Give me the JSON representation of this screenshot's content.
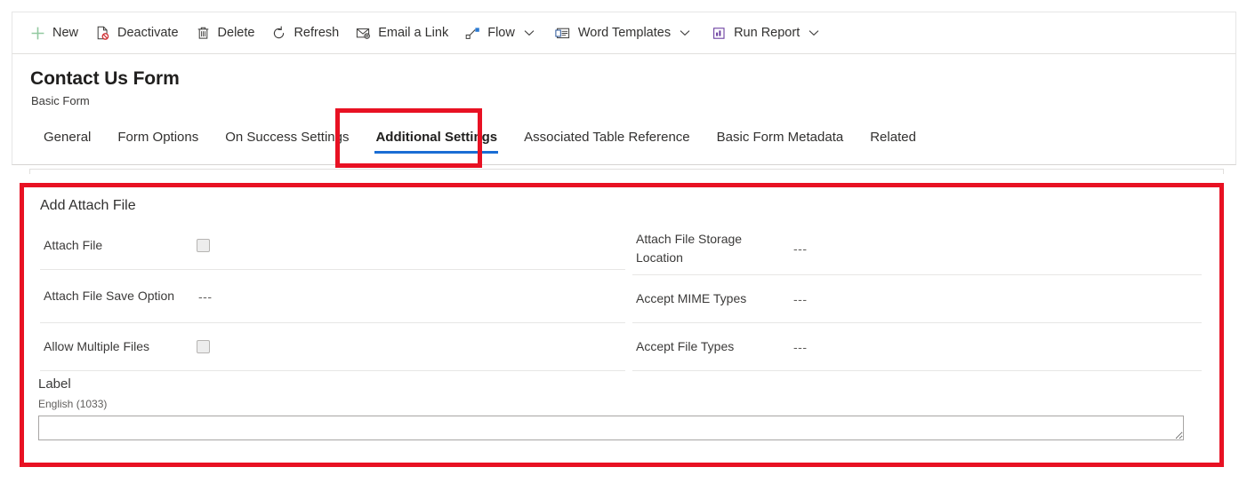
{
  "command_bar": {
    "items": [
      {
        "label": "New",
        "icon": "plus-icon",
        "has_caret": false
      },
      {
        "label": "Deactivate",
        "icon": "deactivate-icon",
        "has_caret": false
      },
      {
        "label": "Delete",
        "icon": "trash-icon",
        "has_caret": false
      },
      {
        "label": "Refresh",
        "icon": "refresh-icon",
        "has_caret": false
      },
      {
        "label": "Email a Link",
        "icon": "email-link-icon",
        "has_caret": false
      },
      {
        "label": "Flow",
        "icon": "flow-icon",
        "has_caret": true
      },
      {
        "label": "Word Templates",
        "icon": "word-templates-icon",
        "has_caret": true
      },
      {
        "label": "Run Report",
        "icon": "run-report-icon",
        "has_caret": true
      }
    ]
  },
  "header": {
    "title": "Contact Us Form",
    "subtitle": "Basic Form",
    "tabs": [
      {
        "label": "General",
        "selected": false
      },
      {
        "label": "Form Options",
        "selected": false
      },
      {
        "label": "On Success Settings",
        "selected": false
      },
      {
        "label": "Additional Settings",
        "selected": true
      },
      {
        "label": "Associated Table Reference",
        "selected": false
      },
      {
        "label": "Basic Form Metadata",
        "selected": false
      },
      {
        "label": "Related",
        "selected": false
      }
    ]
  },
  "form": {
    "section_title": "Add Attach File",
    "left_fields": [
      {
        "label": "Attach File",
        "type": "checkbox",
        "value": "",
        "checked": false
      },
      {
        "label": "Attach File Save Option",
        "type": "text",
        "value": "---"
      },
      {
        "label": "Allow Multiple Files",
        "type": "checkbox",
        "value": "",
        "checked": false
      }
    ],
    "right_fields": [
      {
        "label": "Attach File Storage Location",
        "type": "text",
        "value": "---"
      },
      {
        "label": "Accept MIME Types",
        "type": "text",
        "value": "---"
      },
      {
        "label": "Accept File Types",
        "type": "text",
        "value": "---"
      }
    ],
    "label_block": {
      "heading": "Label",
      "language": "English (1033)",
      "value": "",
      "placeholder": ""
    }
  },
  "annotations": {
    "highlight_color": "#e81123",
    "boxes": [
      {
        "name": "additional-settings-tab-highlight"
      },
      {
        "name": "add-attach-file-section-highlight"
      }
    ]
  },
  "theme": {
    "accent_blue": "#1a6dd4",
    "new_green": "#92c9a0",
    "flow_blue": "#2a7ad3",
    "report_purple": "#6b3fa0",
    "deactivate_red": "#d13438"
  }
}
